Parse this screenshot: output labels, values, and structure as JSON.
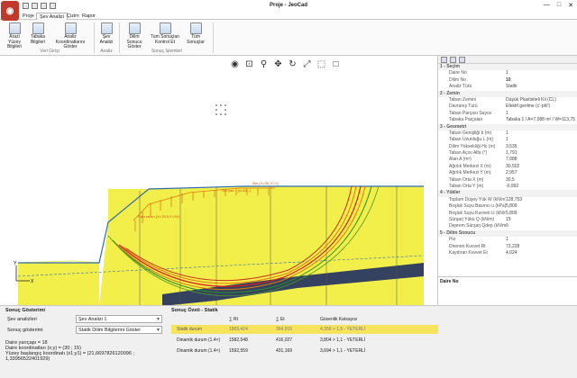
{
  "window": {
    "title": "Proje - JeoCad",
    "minimize": "—",
    "maximize": "□",
    "close": "✕"
  },
  "menu": {
    "tabs": [
      "Proje",
      "Şev Analizi",
      "Çizim",
      "Rapor"
    ],
    "active": 1
  },
  "ribbon": {
    "buttons": [
      "Arazi Yüzey Bilgileri",
      "Tabaka Bilgileri",
      "Analiz Koordinatlarını Göster",
      "Şev Analizi",
      "Dilim Sonucu Göster",
      "Tüm Sonuçları Kontrol Et",
      "Tüm Sonuçlar"
    ],
    "groups": [
      "Veri Girişi",
      "Analiz",
      "Sonuç İşlemleri"
    ]
  },
  "toolbar": {
    "icons": [
      "eye-icon",
      "zoom-window-icon",
      "zoom-icon",
      "pan-icon",
      "rotate-icon",
      "fit-icon",
      "cube-icon",
      "box-icon"
    ]
  },
  "drawing": {
    "colors": {
      "soil_yellow": "#f2ee4a",
      "soil_blue": "#34425f",
      "slope_line": "#2d6bb5",
      "circle_orange": "#e07a10"
    },
    "labels": [
      "Sol yaz... (x=45;..)",
      "Nıs (X=35; Y=?)",
      "Fatlı zehm (X=78.5;Y=29)"
    ]
  },
  "panel": {
    "rows": [
      {
        "cat": "1 - Seçim"
      },
      {
        "k": "Daire No",
        "v": "1"
      },
      {
        "k": "Dilim No",
        "v": "10"
      },
      {
        "k": "Analiz Türü",
        "v": "Statik"
      },
      {
        "cat": "2 - Zemin"
      },
      {
        "k": "Taban Zemini",
        "v": "Düşük Plastisiteli Kil (CL)"
      },
      {
        "k": "Davranış Türü",
        "v": "Efektif gerilme (c'-phi')"
      },
      {
        "k": "Taban Parçası Sayısı",
        "v": "1"
      },
      {
        "k": "Tabaka Parçaları",
        "v": "Tabaka 1 / A=7,088 m² / W=113,75"
      },
      {
        "cat": "3 - Geometri"
      },
      {
        "k": "Taban Genişliği b (m)",
        "v": "1"
      },
      {
        "k": "Taban Uzunluğu L (m)",
        "v": "1"
      },
      {
        "k": "Dilim Yüksekliği Hc (m)",
        "v": "3,535"
      },
      {
        "k": "Taban Açısı Alfa (°)",
        "v": "1,791"
      },
      {
        "k": "Alan A (m²)",
        "v": "7,088"
      },
      {
        "k": "Ağırlık Merkezi X (m)",
        "v": "30,502"
      },
      {
        "k": "Ağırlık Merkezi Y (m)",
        "v": "2,957"
      },
      {
        "k": "Taban Orta X (m)",
        "v": "30,5"
      },
      {
        "k": "Taban Orta Y (m)",
        "v": "-0,992"
      },
      {
        "cat": "4 - Yükler"
      },
      {
        "k": "Toplam Düşey Yük W (kN/m)",
        "v": "128,753"
      },
      {
        "k": "Boşluk Suyu Basıncı u (kPa)",
        "v": "5,809"
      },
      {
        "k": "Boşluk Suyu Kuvveti U (kN/m)",
        "v": "5,809"
      },
      {
        "k": "Sürşarj Yükü Q (kN/m)",
        "v": "15"
      },
      {
        "k": "Deprem Sürşarj Qdep (kN/m)",
        "v": "0"
      },
      {
        "cat": "5 - Dilim Sonucu"
      },
      {
        "k": "Hız",
        "v": "1"
      },
      {
        "k": "Direnen Kuvvet Rt",
        "v": "73,228"
      },
      {
        "k": "Kaydıran Kuvvet Et",
        "v": "4,024"
      }
    ],
    "footer": "Daire No"
  },
  "bottom": {
    "left_title": "Sonuç Gösterimi",
    "sev_label": "Şev analizleri",
    "sev_value": "Şev Analizi 1",
    "sonuc_label": "Sonuç gösterimi",
    "sonuc_value": "Statik Dilim Bilgilerini Göster",
    "info": [
      "Daire yarıçapı = 18",
      "Daire koordinatları (x;y) = (30 ; 15)",
      "Yüzey başlangıç koordinatı (x1;y1) = (21,6697826120096 ;",
      "1,33956522401929)"
    ],
    "right_title": "Sonuç Özeti - Statik",
    "headers": [
      "",
      "∑ Rt",
      "∑ Et",
      "Güvenlik Katsayısı"
    ],
    "rows": [
      [
        "Statik durum",
        "1869,424",
        "364,915",
        "4,356 > 1,5 - YETERLİ"
      ],
      [
        "Dinamik durum (1.4×)",
        "1582,548",
        "416,027",
        "3,804 > 1,1 - YETERLİ"
      ],
      [
        "Dinamik durum (1.4×)",
        "1592,559",
        "431,169",
        "3,694 > 1,1 - YETERLİ"
      ]
    ]
  }
}
